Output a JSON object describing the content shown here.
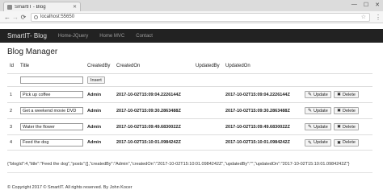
{
  "browser": {
    "tab_title": "SmartIT - Blog",
    "address": "localhost:55650",
    "minimize": "—",
    "maximize": "☐",
    "close": "✕"
  },
  "navbar": {
    "brand": "SmartIT- Blog",
    "links": [
      "Home-JQuery",
      "Home MVC",
      "Contact"
    ]
  },
  "page": {
    "title": "Blog Manager"
  },
  "table": {
    "headers": {
      "id": "Id",
      "title": "Title",
      "created_by": "CreatedBy",
      "created_on": "CreatedOn",
      "updated_by": "UpdatedBy",
      "updated_on": "UpdatedOn"
    },
    "new_title_value": "",
    "insert_label": "Insert",
    "update_label": "Update",
    "delete_label": "Delete",
    "rows": [
      {
        "id": "1",
        "title": "Pick up coffee",
        "created_by": "Admin",
        "created_on": "2017-10-02T15:09:04.2226144Z",
        "updated_by": "",
        "updated_on": "2017-10-02T15:09:04.2226144Z"
      },
      {
        "id": "2",
        "title": "Get a weekend movie DVD",
        "created_by": "Admin",
        "created_on": "2017-10-02T15:09:30.2863488Z",
        "updated_by": "",
        "updated_on": "2017-10-02T15:09:30.2863488Z"
      },
      {
        "id": "3",
        "title": "Water the flower",
        "created_by": "Admin",
        "created_on": "2017-10-02T15:09:49.6830022Z",
        "updated_by": "",
        "updated_on": "2017-10-02T15:09:49.6830022Z"
      },
      {
        "id": "4",
        "title": "Feed the dog",
        "created_by": "Admin",
        "created_on": "2017-10-02T15:10:01.0984242Z",
        "updated_by": "",
        "updated_on": "2017-10-02T15:10:01.0984242Z"
      }
    ]
  },
  "json_output": "{\"blogId\":4,\"title\":\"Feed the dog\",\"posts\":[],\"createdBy\":\"Admin\",\"createdOn\":\"2017-10-02T15:10:01.0984242Z\",\"updatedBy\":\"\",\"updatedOn\":\"2017-10-02T15:10:01.0984242Z\"}",
  "footer": "© Copyright 2017 © SmartIT. All rights reserved. By John Kocer"
}
